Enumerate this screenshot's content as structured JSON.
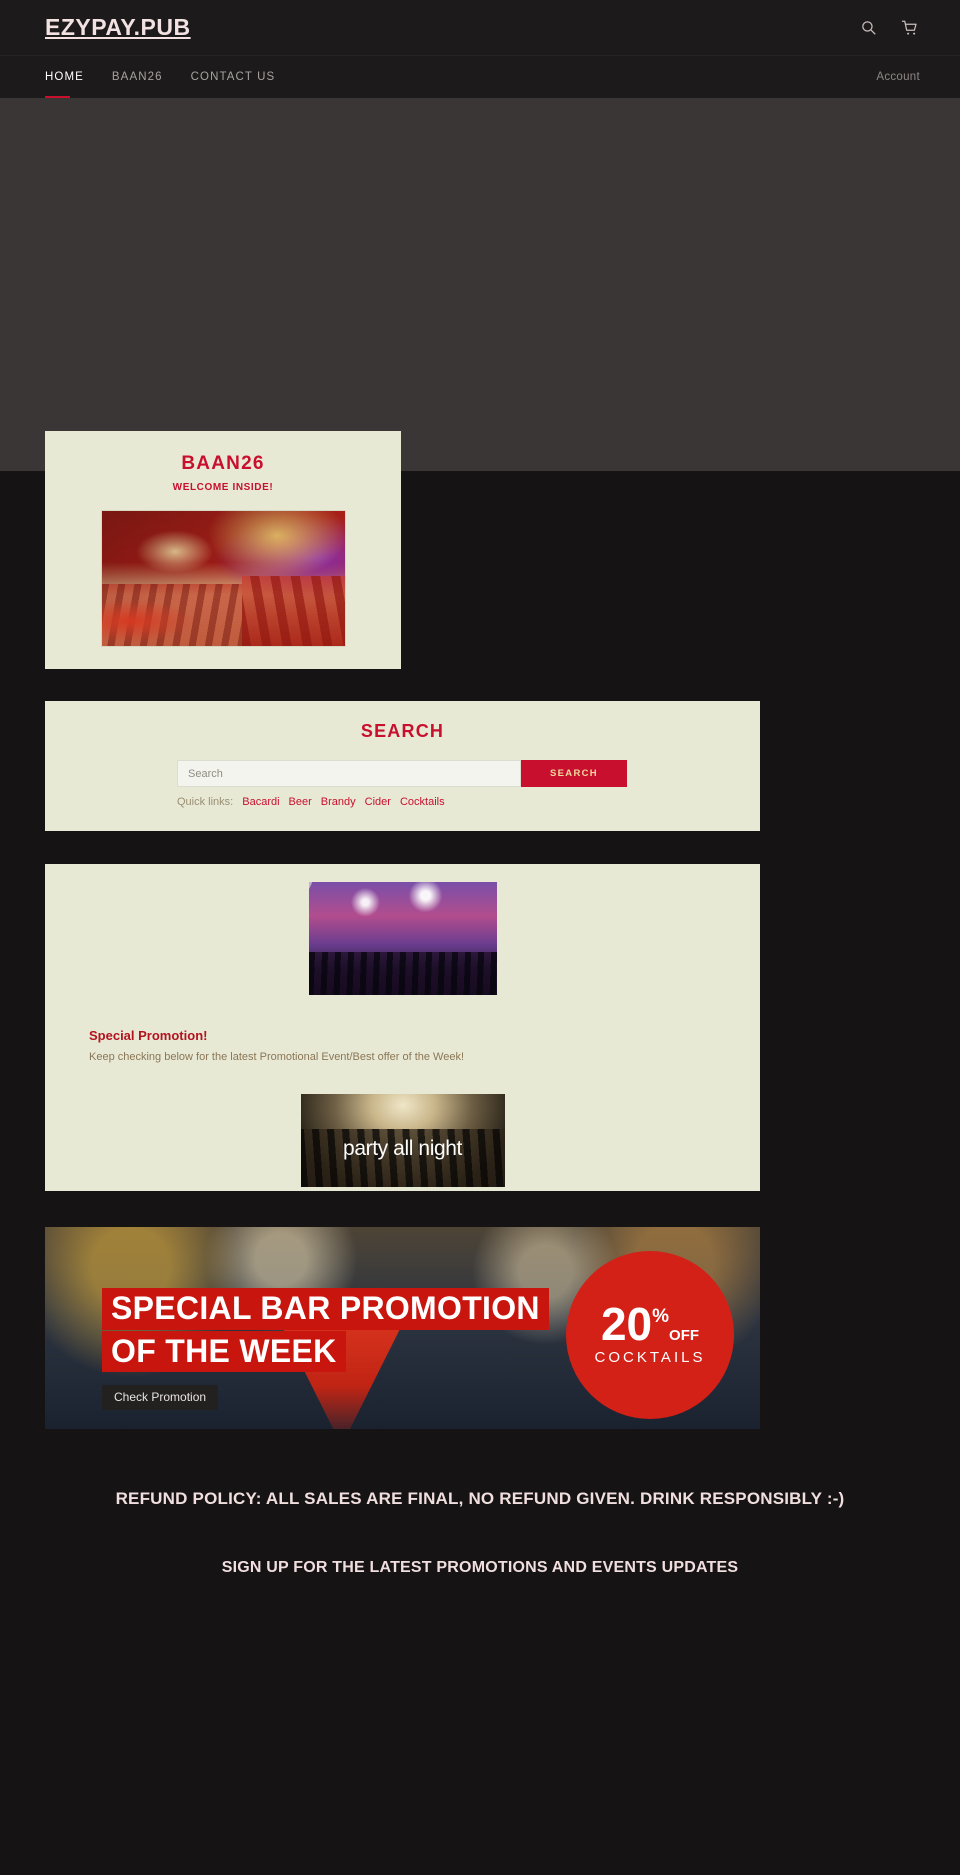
{
  "header": {
    "logo": "EZYPAY.PUB",
    "search_icon": "search-icon",
    "cart_icon": "cart-icon"
  },
  "nav": {
    "items": [
      {
        "label": "HOME",
        "active": true
      },
      {
        "label": "BAAN26",
        "active": false
      },
      {
        "label": "CONTACT US",
        "active": false
      }
    ],
    "account_label": "Account"
  },
  "welcome": {
    "title": "BAAN26",
    "subtitle": "WELCOME INSIDE!",
    "photo_alt": "bar-interior-photo"
  },
  "search": {
    "heading": "SEARCH",
    "placeholder": "Search",
    "value": "",
    "submit_label": "SEARCH",
    "quick_links_label": "Quick links:",
    "quick_links": [
      "Bacardi",
      "Beer",
      "Brandy",
      "Cider",
      "Cocktails"
    ]
  },
  "promotion": {
    "top_image_alt": "concert-crowd-confetti-photo",
    "heading": "Special Promotion!",
    "text": "Keep checking below for the latest Promotional Event/Best offer of the Week!",
    "bottom_image_alt": "party-crowd-photo",
    "bottom_image_caption": "party all night"
  },
  "banner": {
    "headline_line1": "SPECIAL BAR PROMOTION",
    "headline_line2": "OF THE WEEK",
    "cta_label": "Check Promotion",
    "badge_number": "20",
    "badge_percent": "%",
    "badge_off": "OFF",
    "badge_subtitle": "COCKTAILS",
    "accent_red": "#c8160f",
    "badge_red": "#d32118"
  },
  "footer": {
    "refund_policy": "REFUND POLICY: ALL SALES ARE FINAL, NO REFUND GIVEN. DRINK RESPONSIBLY :-)",
    "signup_heading": "SIGN UP FOR THE LATEST PROMOTIONS AND EVENTS UPDATES"
  },
  "colors": {
    "page_background": "#151313",
    "header_background": "#1c1a1a",
    "hero_background": "#3a3636",
    "card_cream": "#e8e9d5",
    "brand_red": "#c8102e"
  }
}
